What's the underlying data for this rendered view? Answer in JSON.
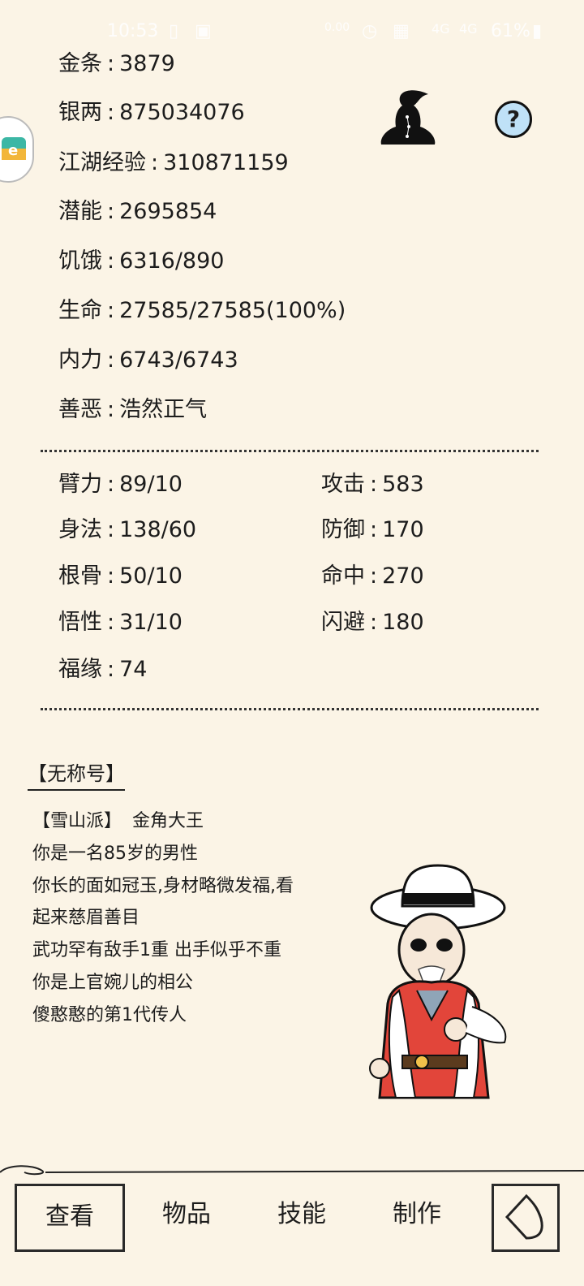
{
  "status_bar": {
    "time": "10:53",
    "net_speed": "0.00",
    "signal_1": "4G",
    "signal_2": "4G",
    "battery": "61%"
  },
  "profile": {
    "gold_label": "金条",
    "gold_value": "3879",
    "silver_label": "银两",
    "silver_value": "875034076",
    "exp_label": "江湖经验",
    "exp_value": "310871159",
    "potential_label": "潜能",
    "potential_value": "2695854",
    "hunger_label": "饥饿",
    "hunger_value": "6316/890",
    "life_label": "生命",
    "life_value": "27585/27585(100%)",
    "inner_label": "内力",
    "inner_value": "6743/6743",
    "morality_label": "善恶",
    "morality_value": "浩然正气"
  },
  "attributes": {
    "strength_label": "臂力",
    "strength_value": "89/10",
    "agility_label": "身法",
    "agility_value": "138/60",
    "constitution_label": "根骨",
    "constitution_value": "50/10",
    "wisdom_label": "悟性",
    "wisdom_value": "31/10",
    "luck_label": "福缘",
    "luck_value": "74",
    "attack_label": "攻击",
    "attack_value": "583",
    "defense_label": "防御",
    "defense_value": "170",
    "hit_label": "命中",
    "hit_value": "270",
    "dodge_label": "闪避",
    "dodge_value": "180"
  },
  "title": "【无称号】",
  "bio": {
    "sect": "【雪山派】",
    "name": "金角大王",
    "line1": "你是一名85岁的男性",
    "line2": "你长的面如冠玉,身材略微发福,看",
    "line3": "起来慈眉善目",
    "line4": "武功罕有敌手1重 出手似乎不重",
    "line5": "你是上官婉儿的相公",
    "line6": "傻憨憨的第1代传人"
  },
  "help_glyph": "?",
  "nav": {
    "view": "查看",
    "items": "物品",
    "skills": "技能",
    "craft": "制作"
  },
  "icons": {
    "meditation": "meditation-icon",
    "help": "help-icon",
    "back": "back-arrow-icon",
    "floating": "floating-ball-icon"
  }
}
